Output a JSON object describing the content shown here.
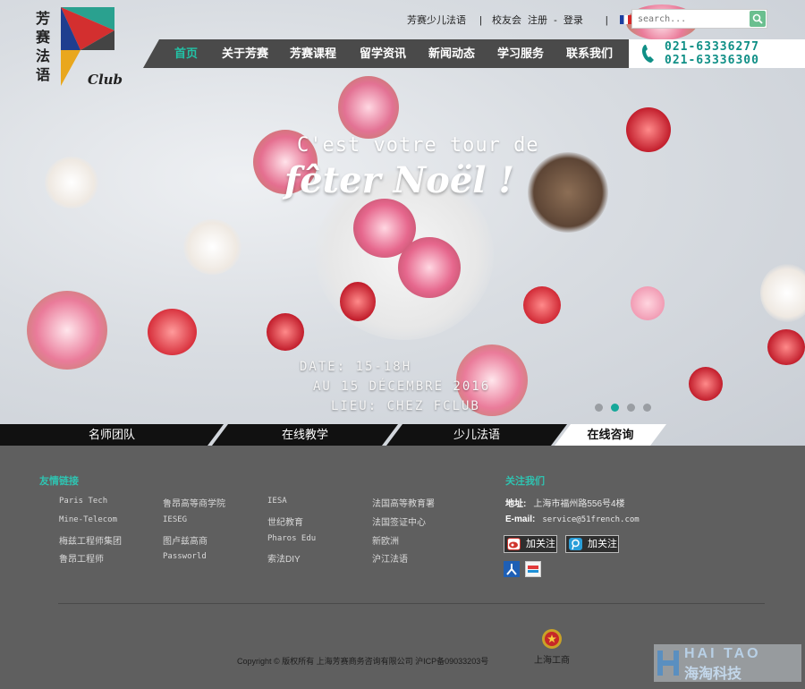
{
  "brand": {
    "name_chars": [
      "芳",
      "赛",
      "法",
      "语"
    ],
    "club": "Club"
  },
  "top_links": {
    "kids": "芳赛少儿法语",
    "alumni": "校友会",
    "register": "注册",
    "sep": "-",
    "login": "登录",
    "lang": "Fr"
  },
  "search": {
    "placeholder": "search..."
  },
  "nav": {
    "items": [
      "首页",
      "关于芳赛",
      "芳赛课程",
      "留学资讯",
      "新闻动态",
      "学习服务",
      "联系我们"
    ],
    "active": 0
  },
  "phones": [
    "021-63336277",
    "021-63336300"
  ],
  "banner": {
    "line1": "C'est votre tour de",
    "line2": "fêter Noël !",
    "event": [
      "DATE: 15-18H",
      "AU 15 DÉCEMBRE 2016",
      "LIEU: CHEZ FCLUB"
    ],
    "slides_total": 4,
    "slide_active": 1
  },
  "tabs": {
    "items": [
      "名师团队",
      "在线教学",
      "少儿法语",
      "在线咨询"
    ],
    "active": 3
  },
  "footer": {
    "links_title": "友情链接",
    "links": [
      [
        "Paris Tech",
        "鲁昂高等商学院",
        "IESA",
        "法国高等教育署"
      ],
      [
        "Mine-Telecom",
        "IESEG",
        "世纪教育",
        "法国签证中心"
      ],
      [
        "梅兹工程师集团",
        "图卢兹高商",
        "Pharos Edu",
        "新欧洲"
      ],
      [
        "鲁昂工程师",
        "Passworld",
        "索法DIY",
        "沪江法语"
      ]
    ],
    "contact_title": "关注我们",
    "address_label": "地址:",
    "address": "上海市福州路556号4楼",
    "email_label": "E-mail:",
    "email": "service@51french.com",
    "follow": [
      "加关注",
      "加关注"
    ],
    "copyright": "Copyright © 版权所有 上海芳赛商务咨询有限公司 沪ICP备09033203号",
    "emblem_label": "上海工商"
  },
  "watermark": {
    "line1": "HAI TAO",
    "line2": "海淘科技"
  },
  "colors": {
    "accent": "#22c2a6",
    "nav_bg": "#4a4a4a",
    "footer_bg": "#5f5f5f",
    "phone": "#0f8f86"
  }
}
